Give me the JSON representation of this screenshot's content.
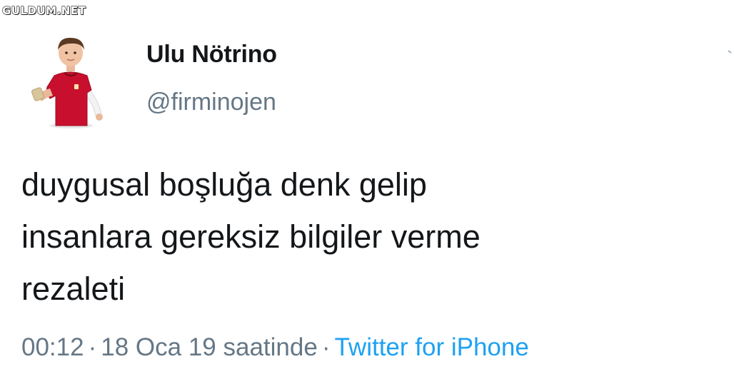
{
  "watermark": "GULDUM.NET",
  "user": {
    "display_name": "Ulu Nötrino",
    "handle": "@firminojen",
    "avatar_icon": "child-in-red-football-jersey-avatar"
  },
  "tweet": {
    "lines": [
      "duygusal boşluğa denk gelip",
      "insanlara gereksiz bilgiler verme",
      "rezaleti"
    ]
  },
  "meta": {
    "time": "00:12",
    "separator": "·",
    "date": "18 Oca 19 saatinde",
    "source": "Twitter for iPhone"
  },
  "colors": {
    "text": "#14171a",
    "secondary": "#657786",
    "link": "#1da1f2"
  }
}
